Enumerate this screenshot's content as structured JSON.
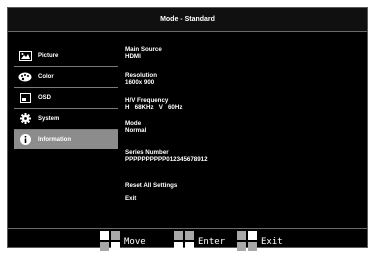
{
  "header": {
    "title": "Mode - Standard"
  },
  "sidebar": {
    "items": [
      {
        "label": "Picture",
        "icon": "picture-icon",
        "selected": false
      },
      {
        "label": "Color",
        "icon": "palette-icon",
        "selected": false
      },
      {
        "label": "OSD",
        "icon": "osd-icon",
        "selected": false
      },
      {
        "label": "System",
        "icon": "gear-icon",
        "selected": false
      },
      {
        "label": "Information",
        "icon": "info-icon",
        "selected": true
      }
    ]
  },
  "info": {
    "main_source": {
      "label": "Main Source",
      "value": "HDMI"
    },
    "resolution": {
      "label": "Resolution",
      "value": "1600x 900"
    },
    "hv_frequency": {
      "label": "H/V Frequency",
      "value": "H   68KHz   V   60Hz"
    },
    "mode": {
      "label": "Mode",
      "value": "Normal"
    },
    "series_number": {
      "label": "Series Number",
      "value": "PPPPPPPPPP012345678912"
    },
    "reset_label": "Reset All Settings",
    "exit_label": "Exit"
  },
  "footer": {
    "move_label": "Move",
    "enter_label": "Enter",
    "exit_label": "Exit"
  },
  "colors": {
    "background": "#000000",
    "selected_item": "#8c8c8c",
    "text": "#ffffff",
    "separator": "#7a7a7a"
  }
}
